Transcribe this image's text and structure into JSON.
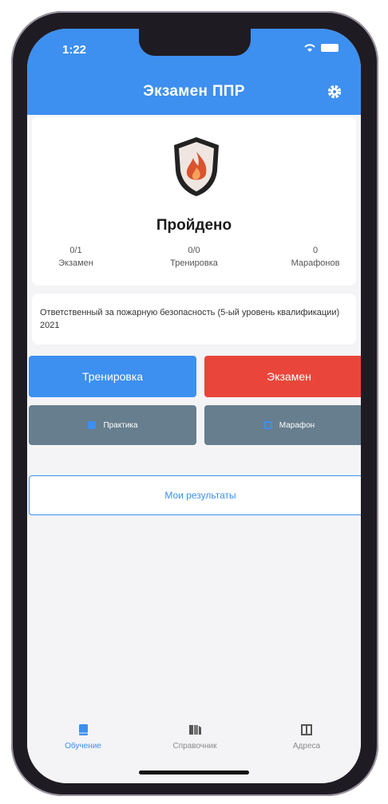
{
  "status_bar": {
    "time": "1:22"
  },
  "header": {
    "title": "Экзамен ППР"
  },
  "summary": {
    "result_label": "Пройдено",
    "stats": [
      {
        "value": "0/1",
        "label": "Экзамен"
      },
      {
        "value": "0/0",
        "label": "Тренировка"
      },
      {
        "value": "0",
        "label": "Марафонов"
      }
    ]
  },
  "description": "Ответственный за пожарную безопасность (5-ый уровень квалификации) 2021",
  "actions": {
    "training": "Тренировка",
    "exam": "Экзамен",
    "practice": "Практика",
    "marathon": "Марафон",
    "results": "Мои результаты"
  },
  "tabs": [
    {
      "label": "Обучение",
      "icon": "book-icon",
      "active": true
    },
    {
      "label": "Справочник",
      "icon": "reference-icon",
      "active": false
    },
    {
      "label": "Адреса",
      "icon": "addresses-icon",
      "active": false
    }
  ],
  "colors": {
    "primary": "#3d8ff0",
    "danger": "#e9453b",
    "secondary": "#667e8e"
  }
}
